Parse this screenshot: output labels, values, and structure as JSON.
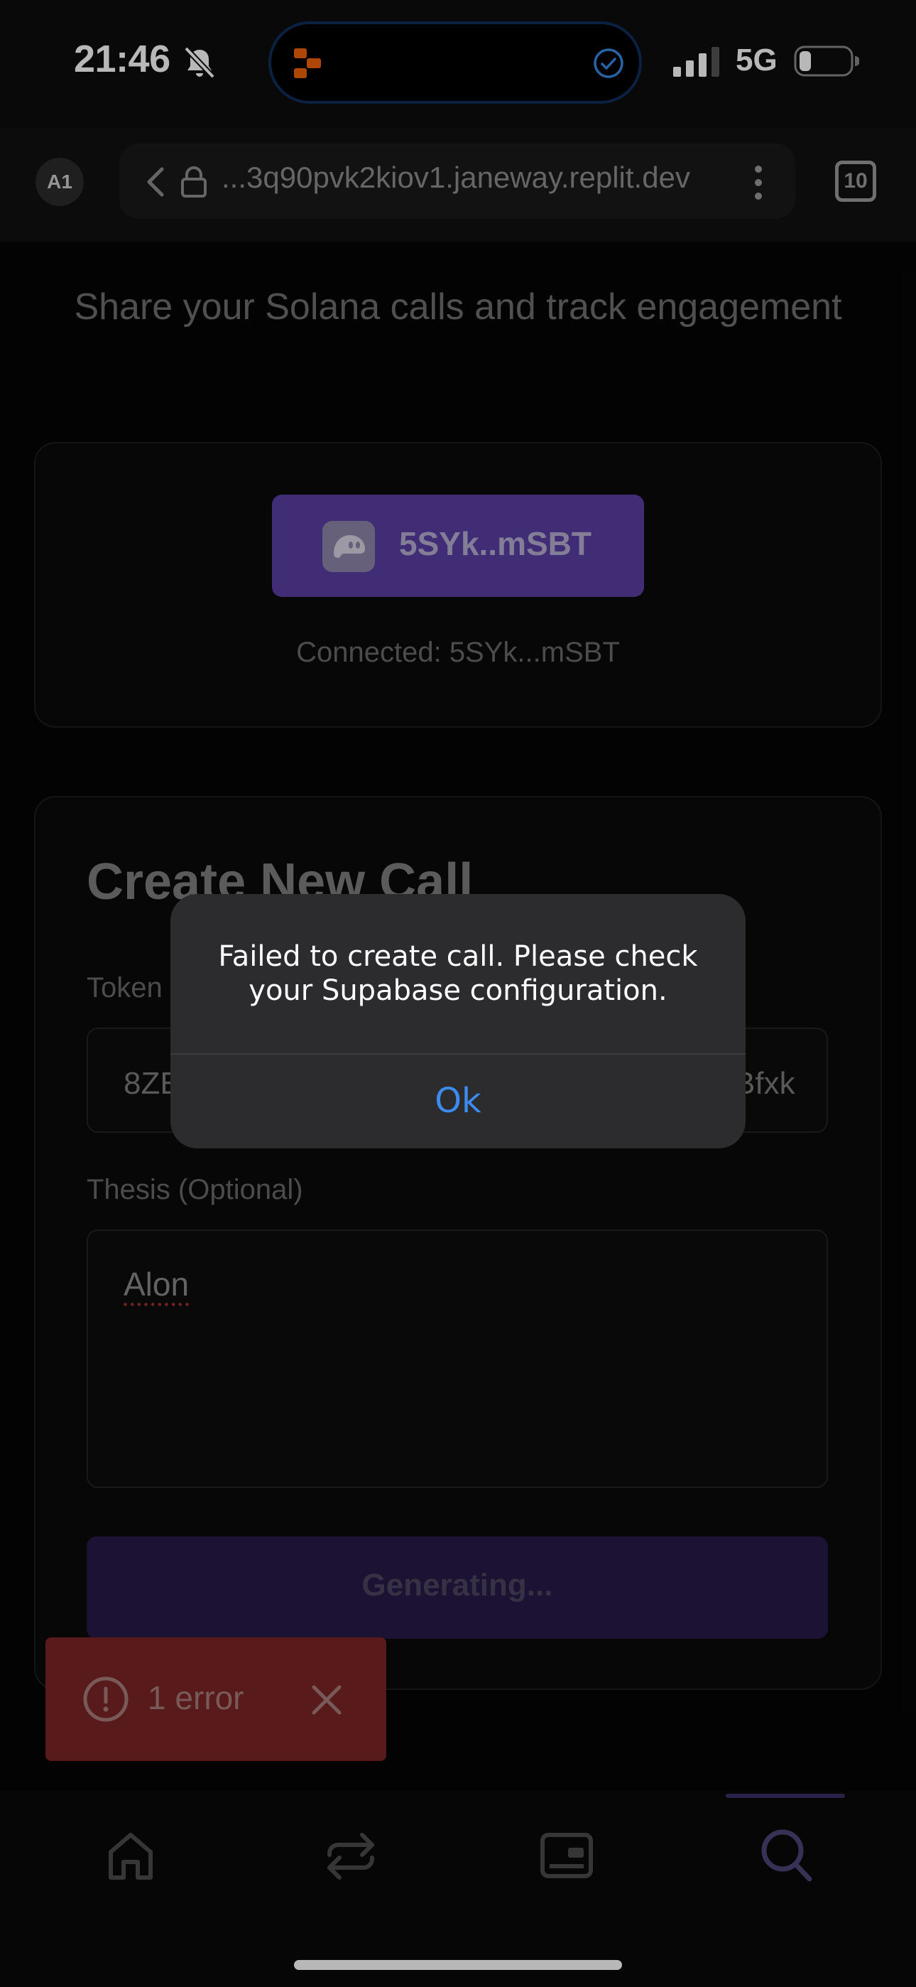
{
  "status_bar": {
    "time": "21:46",
    "network": "5G",
    "icons": [
      "bell-slash-icon",
      "replit-icon",
      "check-circle-icon",
      "signal-icon",
      "battery-icon"
    ]
  },
  "browser": {
    "profile": "A1",
    "url": "...3q90pvk2kiov1.janeway.replit.dev",
    "tab_count": "10"
  },
  "header": {
    "subtitle": "Share your Solana calls and track engagement"
  },
  "wallet": {
    "button_label": "5SYk..mSBT",
    "connected_text": "Connected: 5SYk...mSBT"
  },
  "create_call": {
    "title": "Create New Call",
    "token_label": "Token",
    "token_value_start": "8ZE",
    "token_value_end": "Bfxk",
    "thesis_label": "Thesis (Optional)",
    "thesis_value": "Alon",
    "submit_label": "Generating..."
  },
  "toast": {
    "label": "1 error"
  },
  "alert": {
    "message": "Failed to create call. Please check your Supabase configuration.",
    "ok_label": "Ok"
  },
  "bottom_nav": {
    "items": [
      "home-icon",
      "swap-icon",
      "wallet-icon",
      "search-icon"
    ],
    "active": "search-icon"
  },
  "colors": {
    "accent": "#5b3fa4",
    "alert_button": "#3c8cf0",
    "error": "#7a2525"
  }
}
